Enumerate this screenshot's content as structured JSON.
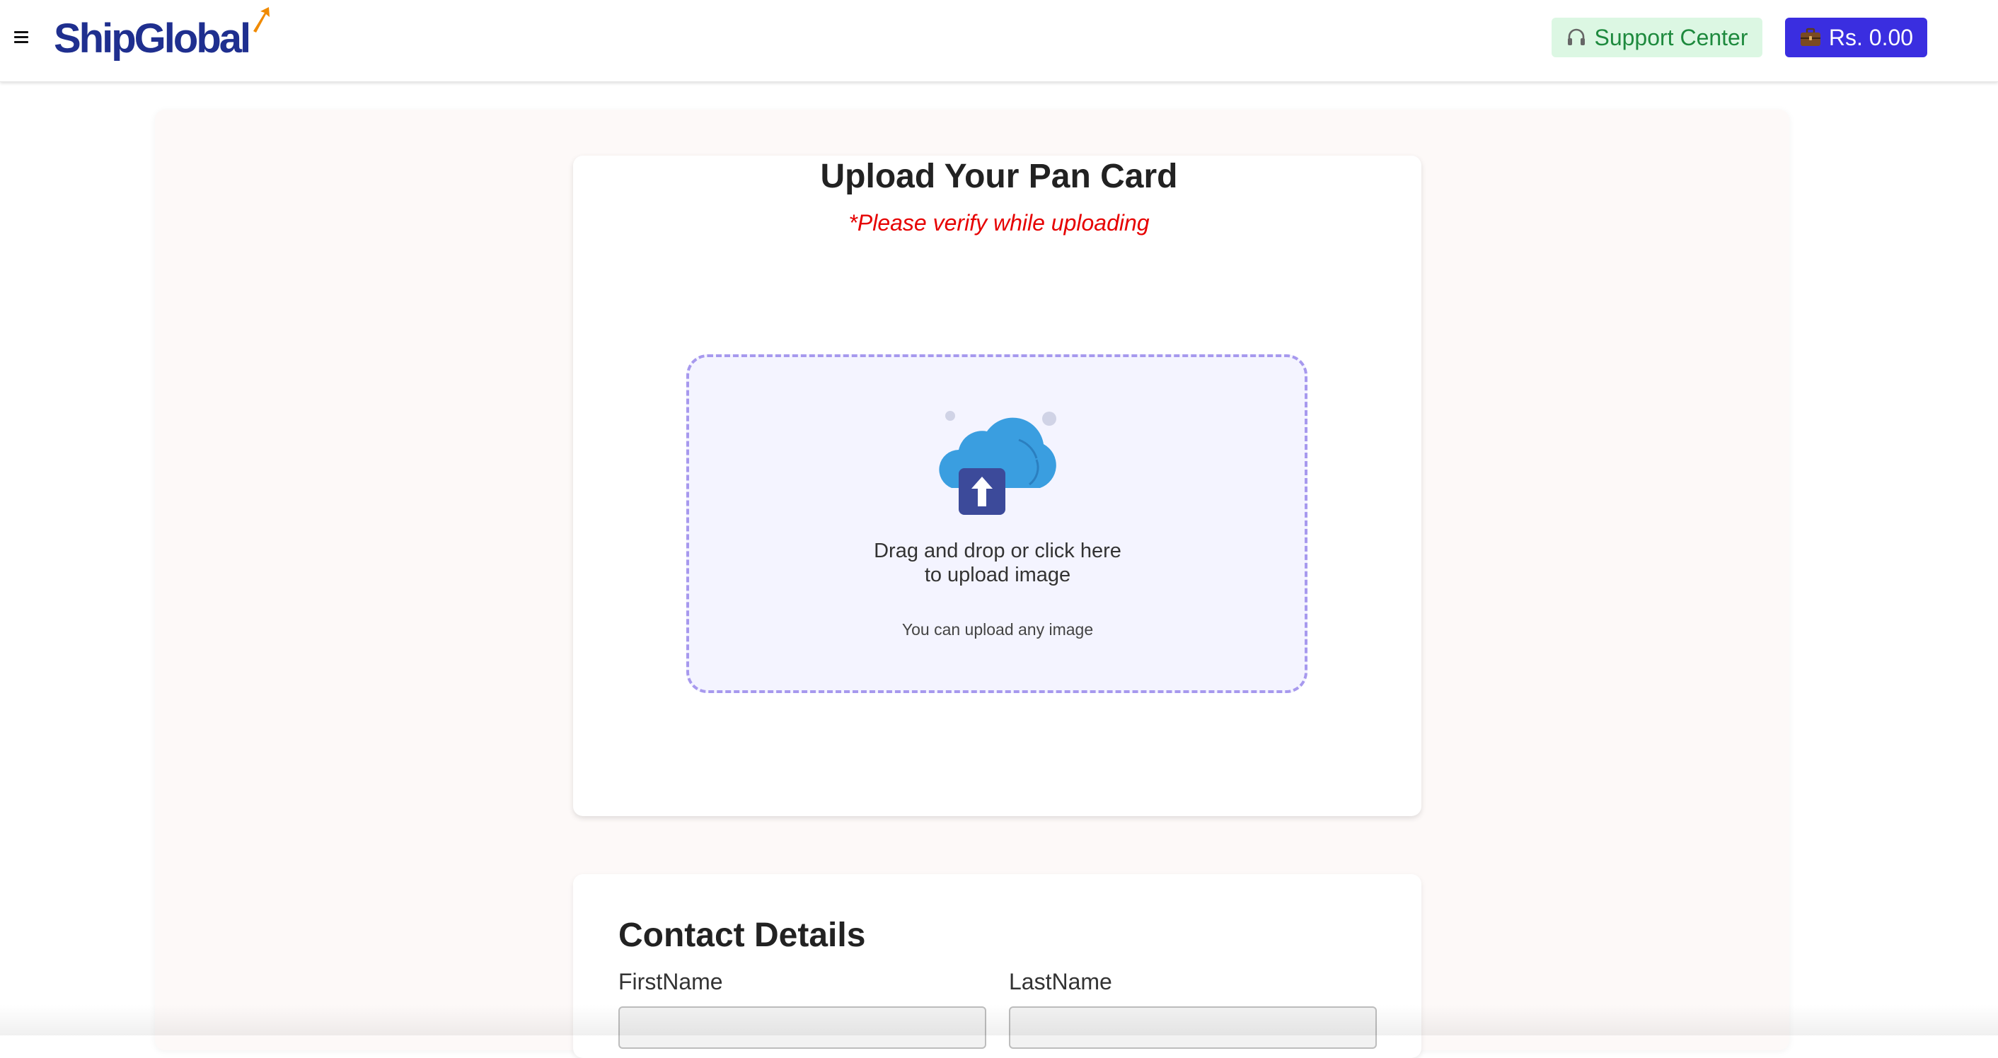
{
  "header": {
    "logo_text": "ShipGlobal",
    "support_label": "Support Center",
    "wallet_label": "Rs. 0.00",
    "icons": {
      "menu": "hamburger-icon",
      "support": "headset-icon",
      "wallet": "briefcase-icon"
    }
  },
  "upload": {
    "title": "Upload Your Pan Card",
    "hint": "*Please verify while uploading",
    "drop_line1": "Drag and drop or click here",
    "drop_line2": "to upload image",
    "sub_text": "You can upload any image",
    "icon": "cloud-upload-icon"
  },
  "contact": {
    "title": "Contact Details",
    "first_name_label": "FirstName",
    "first_name_value": "",
    "last_name_label": "LastName",
    "last_name_value": ""
  },
  "colors": {
    "brand": "#1f2f8f",
    "accent_orange": "#f08a00",
    "wallet_bg": "#3a2ee0",
    "support_bg": "#dcf7e3",
    "support_text": "#1e8a3e",
    "warning_text": "#e60000",
    "dropzone_border": "#a799ee",
    "dropzone_bg": "#f4f4ff"
  }
}
